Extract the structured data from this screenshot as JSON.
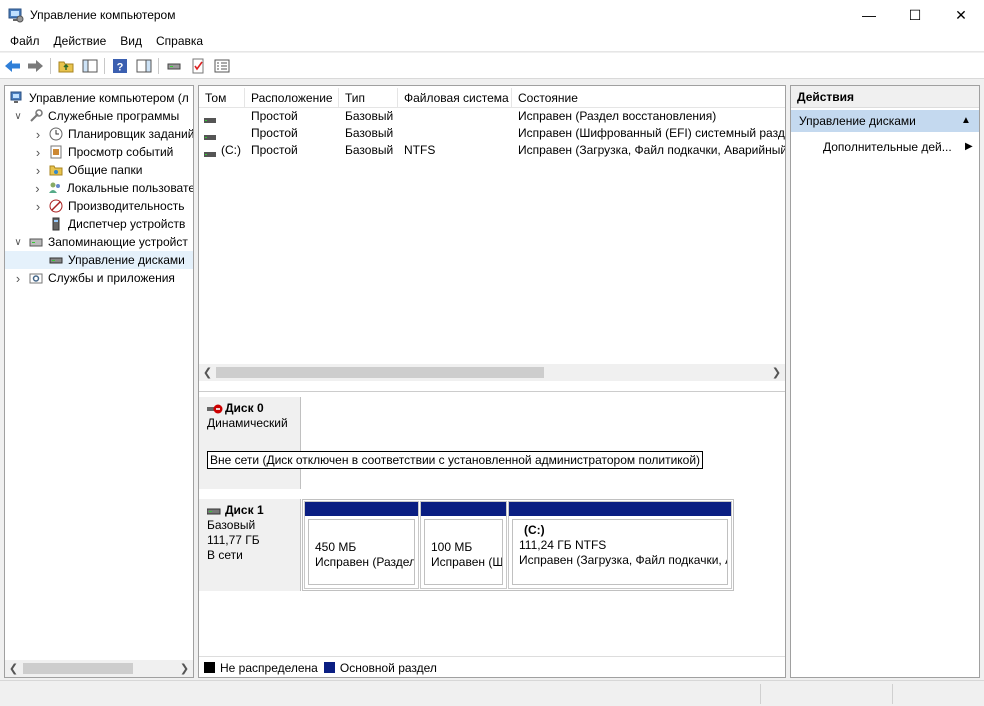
{
  "window": {
    "title": "Управление компьютером"
  },
  "menu": [
    "Файл",
    "Действие",
    "Вид",
    "Справка"
  ],
  "tree": {
    "items": [
      {
        "label": "Управление компьютером (л",
        "level": 0,
        "expander": "",
        "icon": "computer-management-icon"
      },
      {
        "label": "Служебные программы",
        "level": 1,
        "expander": "open",
        "icon": "tools-icon"
      },
      {
        "label": "Планировщик заданий",
        "level": 2,
        "expander": "closed",
        "icon": "clock-icon"
      },
      {
        "label": "Просмотр событий",
        "level": 2,
        "expander": "closed",
        "icon": "event-viewer-icon"
      },
      {
        "label": "Общие папки",
        "level": 2,
        "expander": "closed",
        "icon": "shared-folders-icon"
      },
      {
        "label": "Локальные пользовате",
        "level": 2,
        "expander": "closed",
        "icon": "users-icon"
      },
      {
        "label": "Производительность",
        "level": 2,
        "expander": "closed",
        "icon": "performance-icon"
      },
      {
        "label": "Диспетчер устройств",
        "level": 2,
        "expander": "",
        "icon": "device-manager-icon"
      },
      {
        "label": "Запоминающие устройст",
        "level": 1,
        "expander": "open",
        "icon": "storage-icon"
      },
      {
        "label": "Управление дисками",
        "level": 2,
        "expander": "",
        "icon": "disk-management-icon",
        "selected": true
      },
      {
        "label": "Службы и приложения",
        "level": 1,
        "expander": "closed",
        "icon": "services-icon"
      }
    ]
  },
  "volumes": {
    "columns": [
      "Том",
      "Расположение",
      "Тип",
      "Файловая система",
      "Состояние"
    ],
    "rows": [
      {
        "volume": "",
        "layout": "Простой",
        "type": "Базовый",
        "fs": "",
        "status": "Исправен (Раздел восстановления)"
      },
      {
        "volume": "",
        "layout": "Простой",
        "type": "Базовый",
        "fs": "",
        "status": "Исправен (Шифрованный (EFI) системный разде"
      },
      {
        "volume": "(C:)",
        "layout": "Простой",
        "type": "Базовый",
        "fs": "NTFS",
        "status": "Исправен (Загрузка, Файл подкачки, Аварийный"
      }
    ]
  },
  "disks": {
    "disk0": {
      "name": "Диск 0",
      "type": "Динамический",
      "offline_text": "Вне сети (Диск отключен в соответствии с установленной администратором политикой)"
    },
    "disk1": {
      "name": "Диск 1",
      "type": "Базовый",
      "size": "111,77 ГБ",
      "state": "В сети",
      "partitions": [
        {
          "letter": "",
          "size": "450 МБ",
          "status": "Исправен (Раздел"
        },
        {
          "letter": "",
          "size": "100 МБ",
          "status": "Исправен (Ш"
        },
        {
          "letter": "(C:)",
          "size": "111,24 ГБ NTFS",
          "status": "Исправен (Загрузка, Файл подкачки, А"
        }
      ]
    }
  },
  "legend": {
    "unallocated": "Не распределена",
    "primary": "Основной раздел"
  },
  "actions": {
    "header": "Действия",
    "group": "Управление дисками",
    "more": "Дополнительные дей..."
  },
  "colors": {
    "partition_band": "#0a1e82",
    "unallocated": "#000000",
    "primary": "#0a1e82",
    "selection": "#e5f1fb",
    "actions_group_bg": "#c4d9ef"
  }
}
